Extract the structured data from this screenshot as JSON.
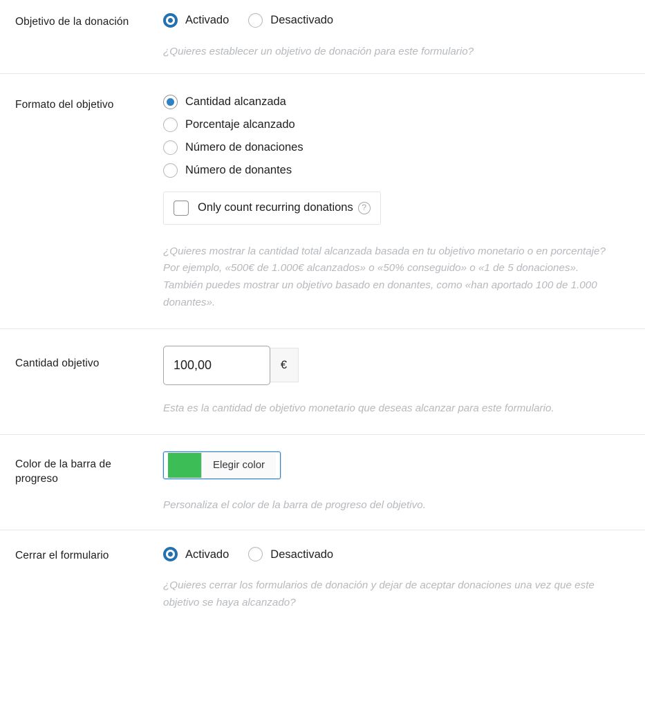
{
  "colors": {
    "accent_blue": "#2271b1",
    "radio_blue": "#2c82c4",
    "progress_green": "#3cbd56",
    "description_gray": "#b6b9bd",
    "divider": "#e7e7e7"
  },
  "sections": {
    "donation_goal": {
      "label": "Objetivo de la donación",
      "options": [
        {
          "label": "Activado",
          "checked": true
        },
        {
          "label": "Desactivado",
          "checked": false
        }
      ],
      "description": "¿Quieres establecer un objetivo de donación para este formulario?"
    },
    "goal_format": {
      "label": "Formato del objetivo",
      "options": [
        {
          "label": "Cantidad alcanzada",
          "checked": true
        },
        {
          "label": "Porcentaje alcanzado",
          "checked": false
        },
        {
          "label": "Número de donaciones",
          "checked": false
        },
        {
          "label": "Número de donantes",
          "checked": false
        }
      ],
      "checkbox": {
        "label": "Only count recurring donations",
        "checked": false,
        "help_icon": "question-mark-circle-icon"
      },
      "description": "¿Quieres mostrar la cantidad total alcanzada basada en tu objetivo monetario o en porcentaje? Por ejemplo, «500€ de 1.000€ alcanzados» o «50% conseguido» o «1 de 5 donaciones». También puedes mostrar un objetivo basado en donantes, como «han aportado 100 de 1.000 donantes»."
    },
    "goal_amount": {
      "label": "Cantidad objetivo",
      "value": "100,00",
      "placeholder": "",
      "currency_suffix": "€",
      "description": "Esta es la cantidad de objetivo monetario que deseas alcanzar para este formulario."
    },
    "progress_bar_color": {
      "label": "Color de la barra de progreso",
      "button_label": "Elegir color",
      "swatch_color": "#3cbd56",
      "description": "Personaliza el color de la barra de progreso del objetivo."
    },
    "close_form": {
      "label": "Cerrar el formulario",
      "options": [
        {
          "label": "Activado",
          "checked": true
        },
        {
          "label": "Desactivado",
          "checked": false
        }
      ],
      "description": "¿Quieres cerrar los formularios de donación y dejar de aceptar donaciones una vez que este objetivo se haya alcanzado?"
    }
  }
}
